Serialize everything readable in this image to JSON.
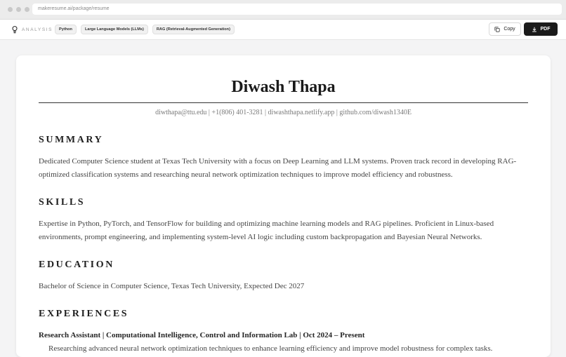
{
  "browser": {
    "url": "makeresume.ai/package/resume"
  },
  "toolbar": {
    "brand": "ANALYSIS",
    "tags": [
      "Python",
      "Large Language Models (LLMs)",
      "RAG (Retrieval-Augmented Generation)"
    ],
    "copy_label": "Copy",
    "pdf_label": "PDF"
  },
  "resume": {
    "name": "Diwash Thapa",
    "contact": "diwthapa@ttu.edu | +1(806) 401-3281 | diwashthapa.netlify.app | github.com/diwash1340E",
    "summary_heading": "SUMMARY",
    "summary_text": "Dedicated Computer Science student at Texas Tech University with a focus on Deep Learning and LLM systems. Proven track record in developing RAG-optimized classification systems and researching neural network optimization techniques to improve model efficiency and robustness.",
    "skills_heading": "SKILLS",
    "skills_text": "Expertise in Python, PyTorch, and TensorFlow for building and optimizing machine learning models and RAG pipelines. Proficient in Linux-based environments, prompt engineering, and implementing system-level AI logic including custom backpropagation and Bayesian Neural Networks.",
    "education_heading": "EDUCATION",
    "education_text": "Bachelor of Science in Computer Science, Texas Tech University, Expected Dec 2027",
    "experiences_heading": "EXPERIENCES",
    "job_title": "Research Assistant | Computational Intelligence, Control and Information Lab | Oct 2024 – Present",
    "job_bullet": "Researching advanced neural network optimization techniques to enhance learning efficiency and improve model robustness for complex tasks."
  }
}
